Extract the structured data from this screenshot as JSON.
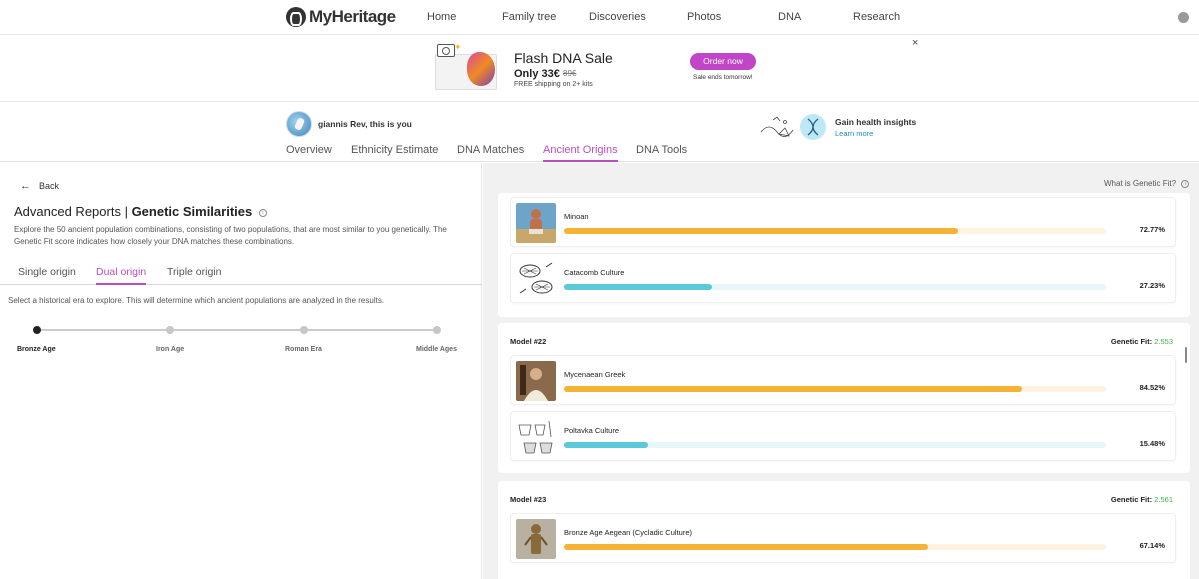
{
  "nav": {
    "logo": "MyHeritage",
    "items": [
      "Home",
      "Family tree",
      "Discoveries",
      "Photos",
      "DNA",
      "Research"
    ]
  },
  "banner": {
    "title": "Flash DNA Sale",
    "price": "Only 33€",
    "old_price": "89€",
    "shipping": "FREE shipping on 2+ kits",
    "cta": "Order now",
    "ends": "Sale ends tomorrow!",
    "close": "×"
  },
  "profile": {
    "name": "giannis Rev, this is you"
  },
  "health": {
    "title": "Gain health insights",
    "link": "Learn more"
  },
  "tabs": [
    "Overview",
    "Ethnicity Estimate",
    "DNA Matches",
    "Ancient Origins",
    "DNA Tools"
  ],
  "left": {
    "back": "Back",
    "title_prefix": "Advanced Reports | ",
    "title_bold": "Genetic Similarities",
    "description": "Explore the 50 ancient population combinations, consisting of two populations, that are most similar to you genetically. The Genetic Fit score indicates how closely your DNA matches these combinations.",
    "origin_tabs": [
      "Single origin",
      "Dual origin",
      "Triple origin"
    ],
    "era_description": "Select a historical era to explore. This will determine which ancient populations are analyzed in the results.",
    "eras": [
      "Bronze Age",
      "Iron Age",
      "Roman Era",
      "Middle Ages"
    ]
  },
  "right": {
    "help": "What is Genetic Fit?",
    "fit_label": "Genetic Fit: ",
    "models": [
      {
        "label": "",
        "fit": "",
        "populations": [
          {
            "name": "Minoan",
            "percent": "72.77%",
            "value": 72.77,
            "color": "#f5b335",
            "track": "#fdf3e0"
          },
          {
            "name": "Catacomb Culture",
            "percent": "27.23%",
            "value": 27.23,
            "color": "#5ac9db",
            "track": "#e7f6f9"
          }
        ]
      },
      {
        "label": "Model #22",
        "fit": "2.553",
        "populations": [
          {
            "name": "Mycenaean Greek",
            "percent": "84.52%",
            "value": 84.52,
            "color": "#f5b335",
            "track": "#fdf3e0"
          },
          {
            "name": "Poltavka Culture",
            "percent": "15.48%",
            "value": 15.48,
            "color": "#5ac9db",
            "track": "#e7f6f9"
          }
        ]
      },
      {
        "label": "Model #23",
        "fit": "2.561",
        "populations": [
          {
            "name": "Bronze Age Aegean (Cycladic Culture)",
            "percent": "67.14%",
            "value": 67.14,
            "color": "#f5b335",
            "track": "#fdf3e0"
          }
        ]
      }
    ]
  }
}
